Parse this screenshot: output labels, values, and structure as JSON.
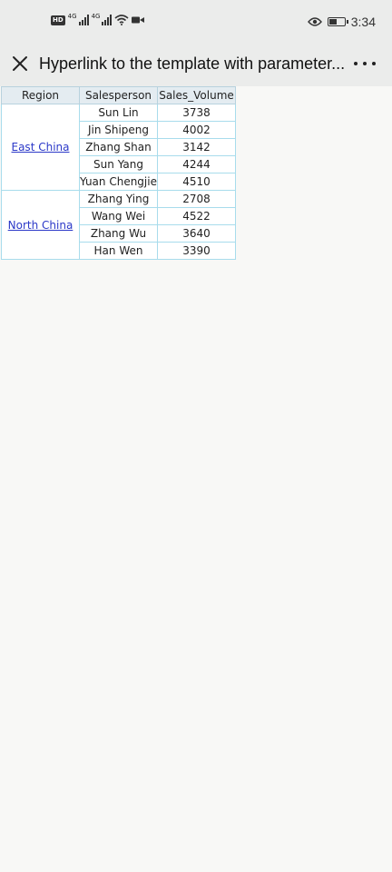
{
  "status_bar": {
    "hd_badge": "HD",
    "network_1": "4G",
    "network_2": "4G",
    "time": "3:34"
  },
  "title_bar": {
    "title": "Hyperlink to the template with parameter...",
    "close_icon": "close-icon",
    "more_icon": "more-options-icon"
  },
  "table": {
    "headers": {
      "region": "Region",
      "salesperson": "Salesperson",
      "sales_volume": "Sales_Volume"
    },
    "groups": [
      {
        "region": "East China",
        "rows": [
          {
            "salesperson": "Sun Lin",
            "volume": "3738"
          },
          {
            "salesperson": "Jin Shipeng",
            "volume": "4002"
          },
          {
            "salesperson": "Zhang Shan",
            "volume": "3142"
          },
          {
            "salesperson": "Sun Yang",
            "volume": "4244"
          },
          {
            "salesperson": "Yuan Chengjie",
            "volume": "4510"
          }
        ]
      },
      {
        "region": "North China",
        "rows": [
          {
            "salesperson": "Zhang Ying",
            "volume": "2708"
          },
          {
            "salesperson": "Wang Wei",
            "volume": "4522"
          },
          {
            "salesperson": "Zhang Wu",
            "volume": "3640"
          },
          {
            "salesperson": "Han Wen",
            "volume": "3390"
          }
        ]
      }
    ]
  },
  "colors": {
    "link": "#2b38c8",
    "cell_border": "#a8dcec",
    "header_bg": "#e4ecf1",
    "bar_bg": "#ebeceb"
  }
}
